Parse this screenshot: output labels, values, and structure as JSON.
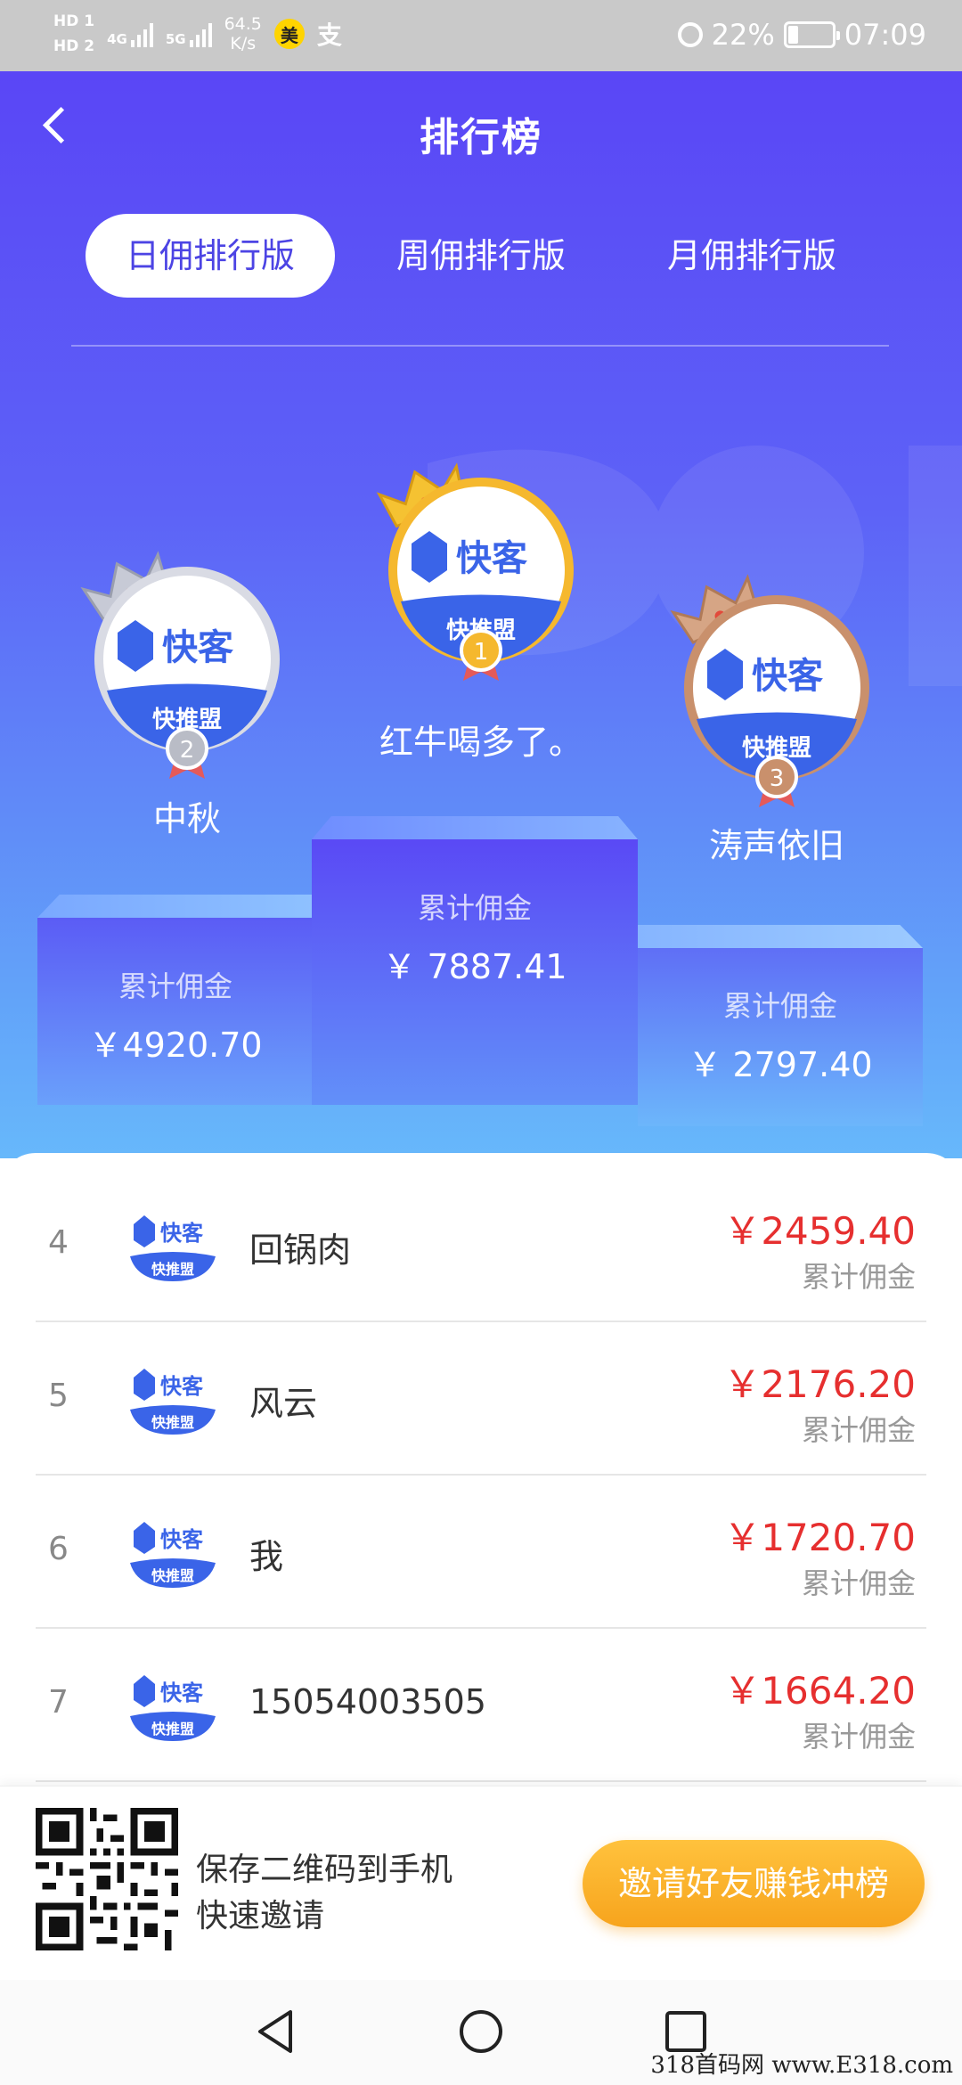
{
  "status_bar": {
    "hd1": "HD 1",
    "hd2": "HD 2",
    "net1": "4G",
    "net2": "5G",
    "speed_value": "64.5",
    "speed_unit": "K/s",
    "meituan_badge": "美",
    "alipay_icon": "支",
    "battery": "22%",
    "battery_level": 0.22,
    "time": "07:09"
  },
  "header": {
    "title": "排行榜"
  },
  "tabs": [
    {
      "label": "日佣排行版",
      "active": true
    },
    {
      "label": "周佣排行版",
      "active": false
    },
    {
      "label": "月佣排行版",
      "active": false
    }
  ],
  "podium": {
    "first": {
      "rank": "1",
      "name": "红牛喝多了。",
      "label": "累计佣金",
      "amount": "￥ 7887.41"
    },
    "second": {
      "rank": "2",
      "name": "中秋",
      "label": "累计佣金",
      "amount": "￥4920.70"
    },
    "third": {
      "rank": "3",
      "name": "涛声依旧",
      "label": "累计佣金",
      "amount": "￥ 2797.40"
    }
  },
  "avatar_logo": {
    "brand": "快客",
    "sub": "快推盟"
  },
  "list": [
    {
      "rank": "4",
      "name": "回锅肉",
      "amount": "￥2459.40",
      "label": "累计佣金"
    },
    {
      "rank": "5",
      "name": "风云",
      "amount": "￥2176.20",
      "label": "累计佣金"
    },
    {
      "rank": "6",
      "name": "我",
      "amount": "￥1720.70",
      "label": "累计佣金"
    },
    {
      "rank": "7",
      "name": "15054003505",
      "amount": "￥1664.20",
      "label": "累计佣金"
    }
  ],
  "bottom": {
    "qr_line1": "保存二维码到手机",
    "qr_line2": "快速邀请",
    "invite_button": "邀请好友赚钱冲榜"
  },
  "corner_watermark": "318首码网 www.E318.com",
  "colors": {
    "hero_top": "#5a46f6",
    "hero_bottom": "#67b8fb",
    "amount_red": "#e62f2f",
    "invite_orange": "#f7a41d",
    "gold": "#f5b82e",
    "silver": "#b9bcc6",
    "bronze": "#c9906c"
  }
}
